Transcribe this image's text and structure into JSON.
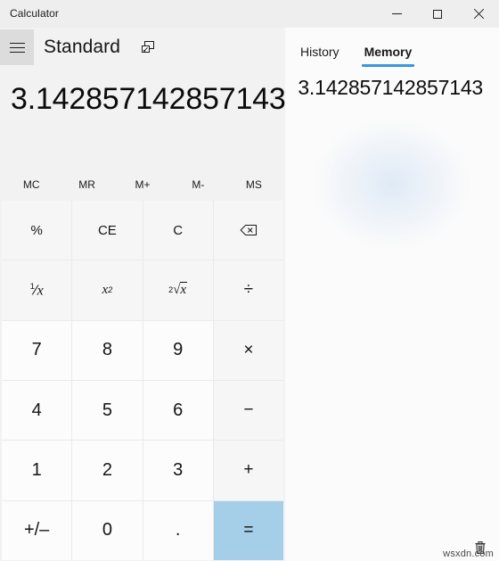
{
  "window": {
    "title": "Calculator",
    "caption": {
      "minimize": "minimize",
      "maximize": "maximize",
      "close": "close"
    }
  },
  "header": {
    "menu_label": "hamburger-menu",
    "mode": "Standard",
    "keep_on_top_label": "Keep on top"
  },
  "display": {
    "value": "3.142857142857143"
  },
  "memory_buttons": [
    {
      "label": "MC",
      "name": "memory-clear"
    },
    {
      "label": "MR",
      "name": "memory-recall"
    },
    {
      "label": "M+",
      "name": "memory-add"
    },
    {
      "label": "M-",
      "name": "memory-subtract"
    },
    {
      "label": "MS",
      "name": "memory-store"
    }
  ],
  "keypad": {
    "rows": [
      [
        {
          "label": "%",
          "name": "percent",
          "kind": "fn"
        },
        {
          "label": "CE",
          "name": "clear-entry",
          "kind": "fn"
        },
        {
          "label": "C",
          "name": "clear",
          "kind": "fn"
        },
        {
          "label": "⌫",
          "name": "backspace",
          "kind": "fn"
        }
      ],
      [
        {
          "label": "1/x",
          "name": "reciprocal",
          "kind": "fn"
        },
        {
          "label": "x²",
          "name": "square",
          "kind": "fn"
        },
        {
          "label": "²√x",
          "name": "square-root",
          "kind": "fn"
        },
        {
          "label": "÷",
          "name": "divide",
          "kind": "op"
        }
      ],
      [
        {
          "label": "7",
          "name": "seven",
          "kind": "num"
        },
        {
          "label": "8",
          "name": "eight",
          "kind": "num"
        },
        {
          "label": "9",
          "name": "nine",
          "kind": "num"
        },
        {
          "label": "×",
          "name": "multiply",
          "kind": "op"
        }
      ],
      [
        {
          "label": "4",
          "name": "four",
          "kind": "num"
        },
        {
          "label": "5",
          "name": "five",
          "kind": "num"
        },
        {
          "label": "6",
          "name": "six",
          "kind": "num"
        },
        {
          "label": "−",
          "name": "subtract",
          "kind": "op"
        }
      ],
      [
        {
          "label": "1",
          "name": "one",
          "kind": "num"
        },
        {
          "label": "2",
          "name": "two",
          "kind": "num"
        },
        {
          "label": "3",
          "name": "three",
          "kind": "num"
        },
        {
          "label": "+",
          "name": "add",
          "kind": "op"
        }
      ],
      [
        {
          "label": "+/–",
          "name": "negate",
          "kind": "num"
        },
        {
          "label": "0",
          "name": "zero",
          "kind": "num"
        },
        {
          "label": ".",
          "name": "decimal-point",
          "kind": "num"
        },
        {
          "label": "=",
          "name": "equals",
          "kind": "equals"
        }
      ]
    ]
  },
  "side_panel": {
    "tabs": [
      {
        "label": "History",
        "name": "tab-history",
        "active": false
      },
      {
        "label": "Memory",
        "name": "tab-memory",
        "active": true
      }
    ],
    "memory_items": [
      {
        "value": "3.142857142857143"
      }
    ],
    "clear_all_label": "Clear all memory"
  },
  "watermark": {
    "text": "wsxdn.com"
  },
  "colors": {
    "accent": "#3a96dd",
    "equals": "#a5cfe8",
    "window_bg": "#f2f2f2",
    "panel_bg": "#fbfbfb"
  }
}
